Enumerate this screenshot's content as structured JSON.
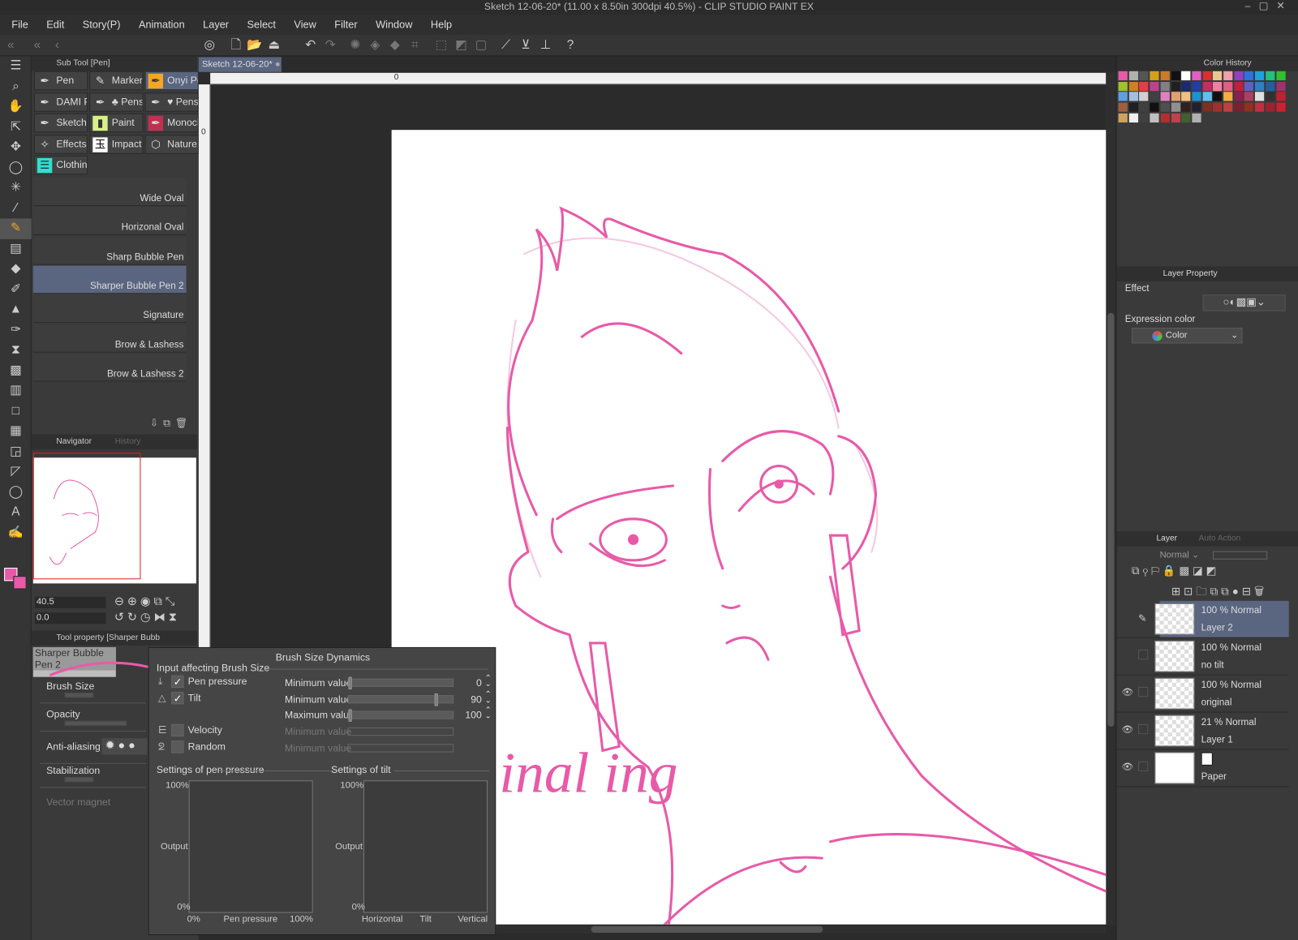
{
  "window": {
    "title": "Sketch 12-06-20* (11.00 x 8.50in 300dpi 40.5%) - CLIP STUDIO PAINT EX"
  },
  "menu": [
    "File",
    "Edit",
    "Story(P)",
    "Animation",
    "Layer",
    "Select",
    "View",
    "Filter",
    "Window",
    "Help"
  ],
  "subtool": {
    "tab": "Sub Tool [Pen]",
    "groups": [
      {
        "label": "Pen",
        "icon": "pen-icon"
      },
      {
        "label": "Marker",
        "icon": "marker-icon"
      },
      {
        "label": "Onyi Pe",
        "icon": "pen-icon",
        "selected": true
      },
      {
        "label": "DAMI P",
        "icon": "pen-icon"
      },
      {
        "label": "♣ Pens",
        "icon": "pen-icon"
      },
      {
        "label": "♥ Pens",
        "icon": "pen-icon"
      },
      {
        "label": "Sketch",
        "icon": "pen-icon"
      },
      {
        "label": "Paint",
        "icon": "paint-icon"
      },
      {
        "label": "Monoch",
        "icon": "pen-icon"
      },
      {
        "label": "Effects",
        "icon": "effects-icon"
      },
      {
        "label": "Impact",
        "icon": "impact-icon"
      },
      {
        "label": "Nature",
        "icon": "nature-icon"
      },
      {
        "label": "Clothing",
        "icon": "clothing-icon"
      }
    ],
    "brushes": [
      "Wide Oval",
      "Horizonal Oval",
      "Sharp Bubble Pen",
      "Sharper Bubble Pen 2",
      "Signature",
      "Brow & Lashess",
      "Brow & Lashess 2"
    ],
    "selected_brush": "Sharper Bubble Pen 2"
  },
  "navigator": {
    "tab": "Navigator",
    "tab2": "History",
    "zoom": "40.5",
    "rotation": "0.0"
  },
  "tool_property": {
    "tab": "Tool property [Sharper Bubb",
    "brush_name": "Sharper Bubble Pen 2",
    "items": [
      "Brush Size",
      "Opacity",
      "Anti-aliasing",
      "Stabilization",
      "Vector magnet"
    ]
  },
  "document": {
    "tab": "Sketch 12-06-20*",
    "ruler_zero": "0",
    "ruler_v_zero": "0",
    "canvas_text": "inal ing"
  },
  "dialog": {
    "title": "Brush Size Dynamics",
    "group_label": "Input affecting Brush Size",
    "inputs": [
      {
        "label": "Pen pressure",
        "checked": true
      },
      {
        "label": "Tilt",
        "checked": true
      },
      {
        "label": "Velocity",
        "checked": false
      },
      {
        "label": "Random",
        "checked": false
      }
    ],
    "sliders": [
      {
        "label": "Minimum value",
        "value": "0",
        "enabled": true,
        "fraction": 0
      },
      {
        "label": "Minimum value",
        "value": "90",
        "enabled": true,
        "fraction": 0.9
      },
      {
        "label": "Maximum value",
        "value": "100",
        "enabled": true,
        "fraction": 0
      },
      {
        "label": "Minimum value",
        "value": "",
        "enabled": false
      },
      {
        "label": "Minimum value",
        "value": "",
        "enabled": false
      }
    ],
    "pressure_graph": {
      "title": "Settings of pen pressure",
      "y_top": "100%",
      "y_mid": "Output",
      "y_bottom": "0%",
      "x_left": "0%",
      "x_mid": "Pen pressure",
      "x_right": "100%"
    },
    "tilt_graph": {
      "title": "Settings of tilt",
      "y_top": "100%",
      "y_mid": "Output",
      "y_bottom": "0%",
      "x_left": "Horizontal",
      "x_mid": "Tilt",
      "x_right": "Vertical"
    }
  },
  "color_history": {
    "tab": "Color History",
    "colors": [
      "#e85aa8",
      "#b0b0b0",
      "#555555",
      "#d4a017",
      "#c97b2b",
      "#111111",
      "#ffffff",
      "#e060c0",
      "#d83030",
      "#e8c890",
      "#f0a0b0",
      "#9040c0",
      "#3070e0",
      "#20a0e0",
      "#20c080",
      "#30c030",
      "#a0c030",
      "#d08020",
      "#e04040",
      "#c04090",
      "#808080",
      "#202020",
      "#1a2a6a",
      "#2040a0",
      "#c03060",
      "#f080a0",
      "#e06080",
      "#c02040",
      "#6060c0",
      "#3080c0",
      "#2060a0",
      "#a03070",
      "#60a0e0",
      "#a0c0e0",
      "#d0d0d0",
      "#404040",
      "#e080c0",
      "#e0a070",
      "#f0c080",
      "#2090d0",
      "#60c0f0",
      "#101010",
      "#f0b040",
      "#8a2050",
      "#b04060",
      "#e0e0e0",
      "#303030",
      "#c02030",
      "#a06040",
      "#202020",
      "#404040",
      "#101010",
      "#505050",
      "#909090",
      "#302020",
      "#202030",
      "#803020",
      "#a03030",
      "#c04040",
      "#7a2030",
      "#903020",
      "#c03040",
      "#a02030",
      "#d02030",
      "#d0a060",
      "#f0f0f0",
      "#404040",
      "#c0c0c0",
      "#b03030",
      "#c04050",
      "#406030",
      "#b0b0b0"
    ]
  },
  "layer_property": {
    "tab": "Layer Property",
    "effect": "Effect",
    "expression_color": "Expression color",
    "color_value": "Color"
  },
  "layers": {
    "tab": "Layer",
    "tab2": "Auto Action",
    "blend": "Normal",
    "items": [
      {
        "opacity": "100 % Normal",
        "name": "Layer 2",
        "visible": false,
        "selected": true
      },
      {
        "opacity": "100 % Normal",
        "name": "no tilt",
        "visible": false
      },
      {
        "opacity": "100 % Normal",
        "name": "original",
        "visible": true
      },
      {
        "opacity": "21 % Normal",
        "name": "Layer 1",
        "visible": true
      },
      {
        "opacity": "",
        "name": "Paper",
        "visible": true
      }
    ]
  },
  "colors": {
    "accent": "#5a6580",
    "ink": "#e85aa8",
    "selected_tool": "#f5a623"
  }
}
